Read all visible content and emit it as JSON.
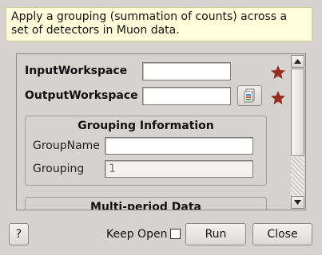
{
  "description": "Apply a grouping (summation of counts) across a set of detectors in Muon data.",
  "fields": {
    "input_workspace": {
      "label": "InputWorkspace",
      "value": ""
    },
    "output_workspace": {
      "label": "OutputWorkspace",
      "value": ""
    }
  },
  "grouping_info": {
    "title": "Grouping Information",
    "group_name": {
      "label": "GroupName",
      "value": ""
    },
    "grouping": {
      "label": "Grouping",
      "placeholder": "1"
    }
  },
  "multi_period": {
    "title": "Multi-period Data"
  },
  "footer": {
    "help_label": "?",
    "keep_open_label": "Keep Open",
    "run_label": "Run",
    "close_label": "Close"
  },
  "colors": {
    "mandatory_star": "#9b2a1e",
    "description_bg": "#ffffdc",
    "window_bg": "#d6d2d0"
  },
  "icons": {
    "mandatory": "star-icon",
    "browse": "workspace-browse-icon"
  }
}
